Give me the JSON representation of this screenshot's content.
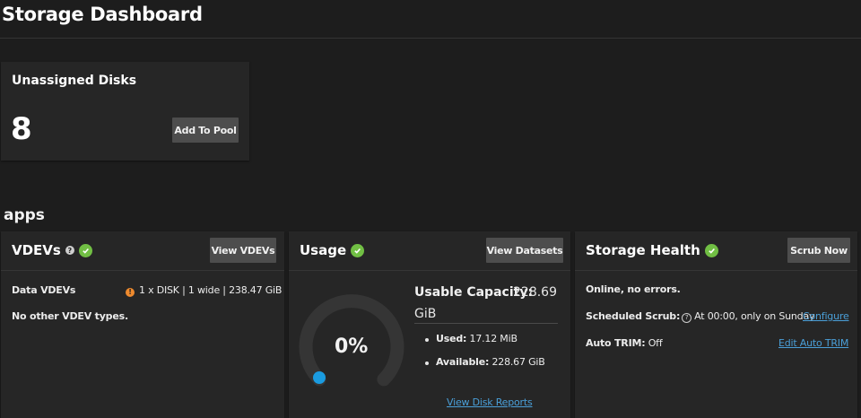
{
  "header": {
    "title": "Storage Dashboard"
  },
  "unassigned": {
    "title": "Unassigned Disks",
    "count": "8",
    "add_button": "Add To Pool"
  },
  "pool": {
    "name": "apps"
  },
  "vdevs": {
    "title": "VDEVs",
    "button": "View VDEVs",
    "data_label": "Data VDEVs",
    "data_value": "1 x DISK | 1 wide | 238.47 GiB",
    "other": "No other VDEV types."
  },
  "usage": {
    "title": "Usage",
    "button": "View Datasets",
    "percent_text": "0%",
    "percent_value": 0,
    "capacity_label": "Usable Capacity:",
    "capacity_value_line1": "228.69",
    "capacity_value_line2": "GiB",
    "used_label": "Used:",
    "used_value": "17.12 MiB",
    "available_label": "Available:",
    "available_value": "228.67 GiB",
    "reports_link": "View Disk Reports"
  },
  "health": {
    "title": "Storage Health",
    "button": "Scrub Now",
    "status": "Online, no errors.",
    "scrub_label": "Scheduled Scrub:",
    "scrub_value": "At 00:00, only on Sunday",
    "scrub_link": "Configure",
    "trim_label": "Auto TRIM:",
    "trim_value": "Off",
    "trim_link": "Edit Auto TRIM"
  },
  "colors": {
    "ok": "#71bf44",
    "warning": "#ee8a2e",
    "link": "#4a9fd8",
    "gauge_dot": "#1a9be0"
  },
  "icons": {
    "ok": "check-circle-icon",
    "help": "help-circle-icon",
    "warning": "warning-circle-icon",
    "info": "info-circle-icon"
  }
}
